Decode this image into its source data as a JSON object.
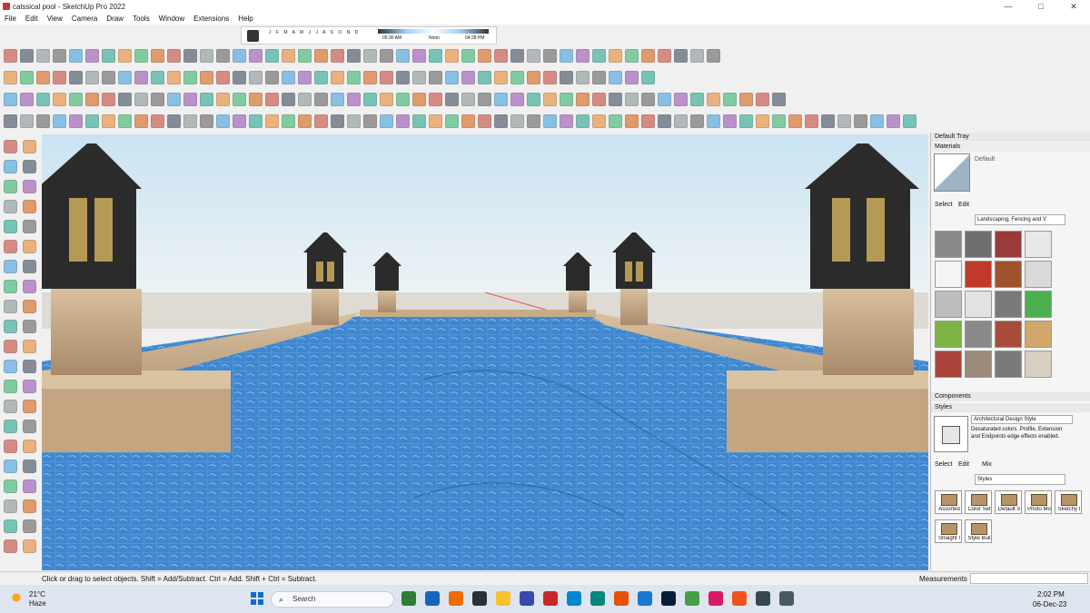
{
  "window": {
    "title": "calssical pool - SketchUp Pro 2022",
    "minimize": "—",
    "maximize": "□",
    "close": "✕"
  },
  "menu": [
    "File",
    "Edit",
    "View",
    "Camera",
    "Draw",
    "Tools",
    "Window",
    "Extensions",
    "Help"
  ],
  "shadows": {
    "months": "J F M A M J J A S O N D",
    "time_start": "05:30 AM",
    "time_mid": "Noon",
    "time_end": "04:28 PM"
  },
  "tray": {
    "title": "Default Tray",
    "materials": {
      "header": "Materials",
      "current": "Default",
      "tab_select": "Select",
      "tab_edit": "Edit",
      "collection": "Landscaping, Fencing and V"
    },
    "components": {
      "header": "Components"
    },
    "styles": {
      "header": "Styles",
      "current_name": "Architectural Design Style",
      "description": "Desaturated colors. Profile, Extension and Endpoints edge effects enabled.",
      "tab_select": "Select",
      "tab_edit": "Edit",
      "tab_mix": "Mix",
      "collection": "Styles",
      "items": [
        "Assorted",
        "Color Set",
        "Default S",
        "Photo Mo",
        "Sketchy I",
        "Straight I",
        "Style Buil"
      ]
    }
  },
  "status": {
    "message": "Click or drag to select objects. Shift = Add/Subtract. Ctrl = Add. Shift + Ctrl = Subtract.",
    "measurements_label": "Measurements"
  },
  "taskbar": {
    "temperature": "21°C",
    "condition": "Haze",
    "search_placeholder": "Search",
    "time": "2:02 PM",
    "date": "06-Dec-23"
  },
  "colors": {
    "sky_top": "#c9e3f2",
    "sky_bottom": "#e8f0f2",
    "ground": "#dedad4",
    "water": "#3f87cf",
    "stone": "#c9ad8c",
    "lantern": "#2b2b2b"
  }
}
